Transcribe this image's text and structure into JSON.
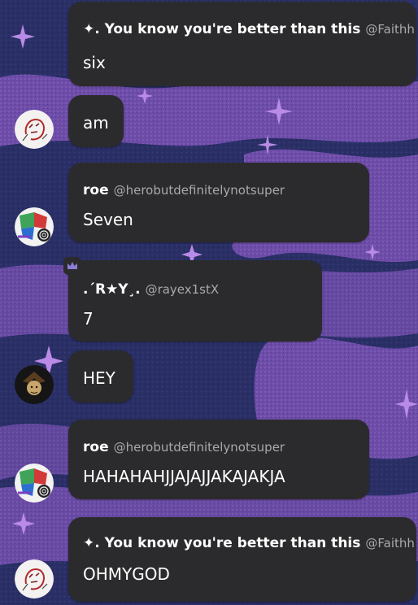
{
  "messages": [
    {
      "sender": "✦. You know you're better than this",
      "handle": "@Faithh",
      "text": "six"
    },
    {
      "text": "am"
    },
    {
      "sender": "roe",
      "handle": "@herobutdefinitelynotsuper",
      "text": "Seven"
    },
    {
      "sender": ".´R★Y¸.",
      "handle": "@rayex1stX",
      "text": "7"
    },
    {
      "text": "HEY"
    },
    {
      "sender": "roe",
      "handle": "@herobutdefinitelynotsuper",
      "text": "HAHAHAHJJAJAJJAKAJAKJA"
    },
    {
      "sender": "✦. You know you're better than this",
      "handle": "@Faithh",
      "text": "OHMYGOD"
    }
  ],
  "icons": {
    "crown": "crown-icon",
    "sparkle": "sparkle-icon"
  },
  "colors": {
    "bubble": "#2b2b2d",
    "background": "#24285c",
    "accent_purple": "#8f63c8"
  }
}
